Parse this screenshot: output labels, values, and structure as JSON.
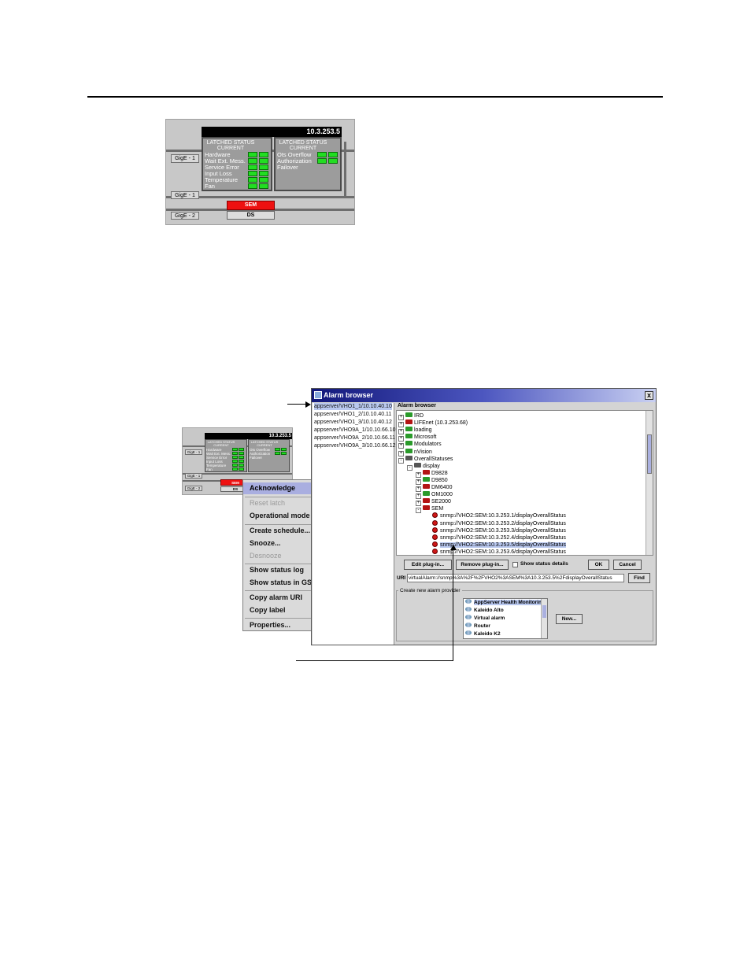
{
  "top_panel": {
    "ip": "10.3.253.5",
    "left_header": [
      "LATCHED STATUS",
      "CURRENT"
    ],
    "left_rows": [
      "Hardware",
      "Wait Ext. Mess.",
      "Service Error",
      "Input Loss",
      "Temperature",
      "Fan"
    ],
    "right_header": [
      "LATCHED STATUS",
      "CURRENT"
    ],
    "right_rows": [
      "Ots Overflow",
      "Authorization",
      "Failover"
    ],
    "gig1_label": "GigE - 1",
    "gig1b_label": "GigE - 1",
    "gig2_label": "GigE - 2",
    "sem_label": "SEM",
    "sem_sub": "DS"
  },
  "small_panel": {
    "ip": "10.3.253.5",
    "left_header": [
      "LATCHED STATUS",
      "CURRENT"
    ],
    "left_rows": [
      "Hardware",
      "Wait Ext. Mess.",
      "Service Error",
      "Input Loss",
      "Temperature",
      "Fan"
    ],
    "right_header": [
      "LATCHED STATUS",
      "CURRENT"
    ],
    "right_rows": [
      "Ots Overflow",
      "Authorization",
      "Failover"
    ],
    "gig1_label": "GigE - 1",
    "gig1b_label": "GigE - 1",
    "gig2_label": "GigE - 2",
    "sem_label": "SEM",
    "sem_sub": "DS"
  },
  "context_menu": {
    "items": [
      {
        "label": "Acknowledge",
        "highlighted": true
      },
      {
        "label": "Reset latch",
        "disabled": true
      },
      {
        "label": "Operational mode",
        "submenu": true
      },
      {
        "label": "Create schedule..."
      },
      {
        "label": "Snooze..."
      },
      {
        "label": "Desnooze",
        "disabled": true
      },
      {
        "label": "Show status log"
      },
      {
        "label": "Show status in GSM browser"
      },
      {
        "label": "Copy alarm URI"
      },
      {
        "label": "Copy label"
      },
      {
        "label": "Properties..."
      }
    ]
  },
  "window": {
    "title": "Alarm browser",
    "close": "x",
    "right_title": "Alarm browser",
    "servers": [
      "appserver/VHO1_1/10.10.40.10",
      "appserver/VHO1_2/10.10.40.11",
      "appserver/VHO1_3/10.10.40.12",
      "appserver/VHO9A_1/10.10.66.10",
      "appserver/VHO9A_2/10.10.66.11",
      "appserver/VHO9A_3/10.10.66.12"
    ],
    "tree": [
      {
        "label": "IRD",
        "folder": "green",
        "indent": 0,
        "exp": "+"
      },
      {
        "label": "LIFEnet (10.3.253.68)",
        "folder": "red",
        "indent": 0,
        "exp": "+"
      },
      {
        "label": "loading",
        "folder": "green",
        "indent": 0,
        "exp": "+"
      },
      {
        "label": "Microsoft",
        "folder": "green",
        "indent": 0,
        "exp": "+"
      },
      {
        "label": "Modulators",
        "folder": "green",
        "indent": 0,
        "exp": "+"
      },
      {
        "label": "nVision",
        "folder": "green",
        "indent": 0,
        "exp": "+"
      },
      {
        "label": "OverallStatuses",
        "folder": "open",
        "indent": 0,
        "exp": "-"
      },
      {
        "label": "display",
        "folder": "open",
        "indent": 1,
        "exp": "-"
      },
      {
        "label": "D9828",
        "folder": "red",
        "indent": 2,
        "exp": "+"
      },
      {
        "label": "D9850",
        "folder": "green",
        "indent": 2,
        "exp": "+"
      },
      {
        "label": "DM6400",
        "folder": "red",
        "indent": 2,
        "exp": "+"
      },
      {
        "label": "OM1000",
        "folder": "green",
        "indent": 2,
        "exp": "+"
      },
      {
        "label": "SE2000",
        "folder": "red",
        "indent": 2,
        "exp": "+"
      },
      {
        "label": "SEM",
        "folder": "red",
        "indent": 2,
        "exp": "-"
      },
      {
        "label": "snmp://VHO2:SEM:10.3.253.1/displayOverallStatus",
        "alarm": true,
        "indent": 3
      },
      {
        "label": "snmp://VHO2:SEM:10.3.253.2/displayOverallStatus",
        "alarm": true,
        "indent": 3
      },
      {
        "label": "snmp://VHO2:SEM:10.3.253.3/displayOverallStatus",
        "alarm": true,
        "indent": 3
      },
      {
        "label": "snmp://VHO2:SEM:10.3.252.4/displayOverallStatus",
        "alarm": true,
        "indent": 3
      },
      {
        "label": "snmp://VHO2:SEM:10.3.253.5/displayOverallStatus",
        "alarm": true,
        "indent": 3,
        "selected": true
      },
      {
        "label": "snmp://VHO2:SEM:10.3.253.6/displayOverallStatus",
        "alarm": true,
        "indent": 3
      }
    ],
    "buttons": {
      "edit": "Edit plug-in...",
      "remove": "Remove plug-in...",
      "details": "Show status details",
      "ok": "OK",
      "cancel": "Cancel",
      "find": "Find",
      "new": "New..."
    },
    "uri_label": "URI",
    "uri_value": "virtualAlarm://snmp%3A%2F%2FVHO2%3ASEM%3A10.3.253.5%2FdisplayOverallStatus",
    "create_title": "Create new alarm provider",
    "providers": [
      {
        "label": "AppServer Health Monitoring",
        "selected": true
      },
      {
        "label": "Kaleido Alto"
      },
      {
        "label": "Virtual alarm"
      },
      {
        "label": "Router"
      },
      {
        "label": "Kaleido K2"
      }
    ]
  }
}
